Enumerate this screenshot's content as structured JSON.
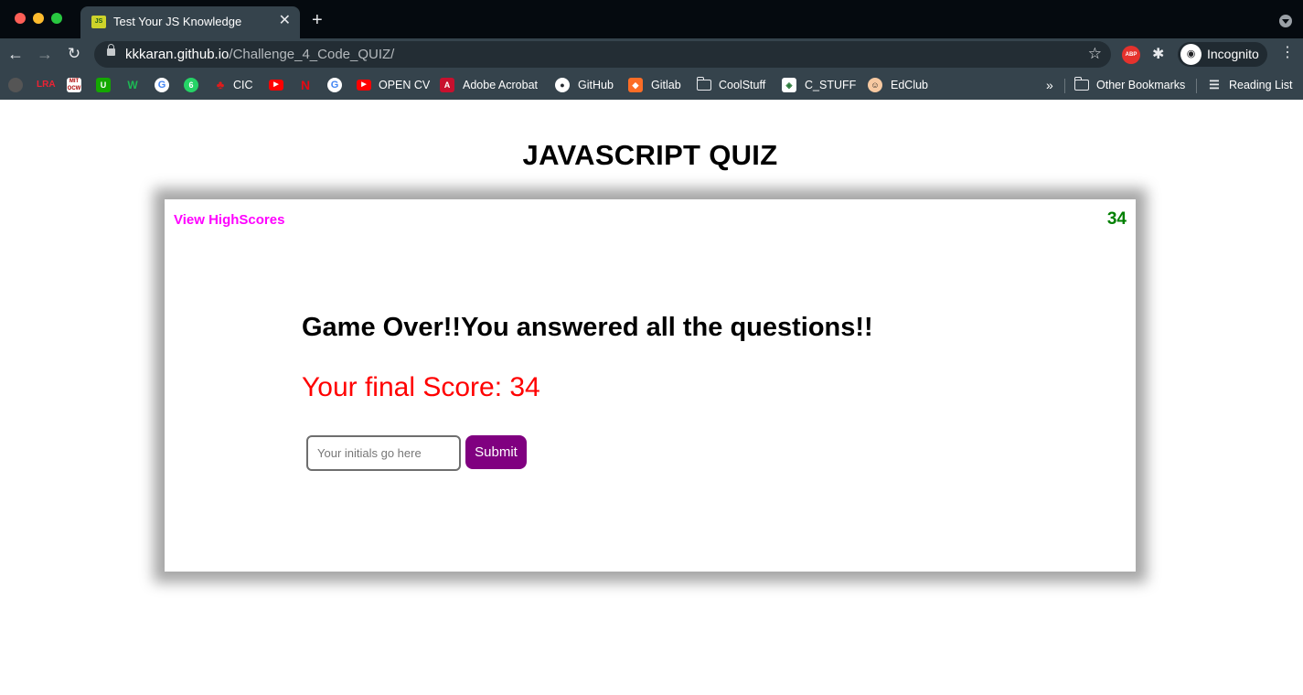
{
  "browser": {
    "tab": {
      "title": "Test Your JS Knowledge",
      "favicon": "quiz-favicon"
    },
    "url": {
      "domain": "kkkaran.github.io",
      "path": "/Challenge_4_Code_QUIZ/"
    },
    "profile_label": "Incognito",
    "extension_abp_label": "ABP",
    "bookmarks": [
      {
        "label": "",
        "icon": "circle-icon"
      },
      {
        "label": "",
        "icon": "lra-icon"
      },
      {
        "label": "",
        "icon": "mit-ocw-icon"
      },
      {
        "label": "",
        "icon": "upwork-icon"
      },
      {
        "label": "",
        "icon": "w-icon"
      },
      {
        "label": "",
        "icon": "google-icon"
      },
      {
        "label": "",
        "icon": "whatsapp-icon"
      },
      {
        "label": "CIC",
        "icon": "maple-leaf-icon"
      },
      {
        "label": "",
        "icon": "youtube-icon"
      },
      {
        "label": "",
        "icon": "netflix-icon"
      },
      {
        "label": "",
        "icon": "google-icon"
      },
      {
        "label": "OPEN CV",
        "icon": "youtube-icon"
      },
      {
        "label": "Adobe Acrobat",
        "icon": "acrobat-icon"
      },
      {
        "label": "GitHub",
        "icon": "github-icon"
      },
      {
        "label": "Gitlab",
        "icon": "gitlab-icon"
      },
      {
        "label": "CoolStuff",
        "icon": "folder-icon"
      },
      {
        "label": "C_STUFF",
        "icon": "cstuff-icon"
      },
      {
        "label": "EdClub",
        "icon": "edclub-icon"
      }
    ],
    "overflow_label": "»",
    "other_bookmarks": "Other Bookmarks",
    "reading_list": "Reading List"
  },
  "page": {
    "title": "JAVASCRIPT QUIZ",
    "highscores_link": "View HighScores",
    "timer": "34",
    "game_over": "Game Over!!You answered all the questions!!",
    "final_score": "Your final Score: 34",
    "initials_placeholder": "Your initials go here",
    "initials_value": "",
    "submit_label": "Submit"
  },
  "colors": {
    "highscores_link": "#ff00ff",
    "timer": "#008000",
    "final_score": "#ff0000",
    "submit_bg": "#800080"
  }
}
